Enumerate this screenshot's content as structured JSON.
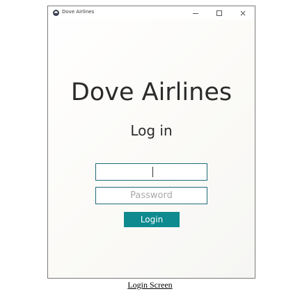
{
  "window": {
    "title": "Dove Airlines",
    "app_icon": "dove-app-icon",
    "controls": {
      "minimize_icon": "minimize-icon",
      "maximize_icon": "maximize-icon",
      "close_icon": "close-icon",
      "close_glyph": "×"
    }
  },
  "login": {
    "heading": "Dove Airlines",
    "subheading": "Log in",
    "username": {
      "value": "",
      "placeholder": ""
    },
    "password": {
      "value": "",
      "placeholder": "Password"
    },
    "button_label": "Login",
    "accent_color": "#0f8a8f",
    "field_border_color": "#1e6a78"
  },
  "caption": "Login Screen"
}
